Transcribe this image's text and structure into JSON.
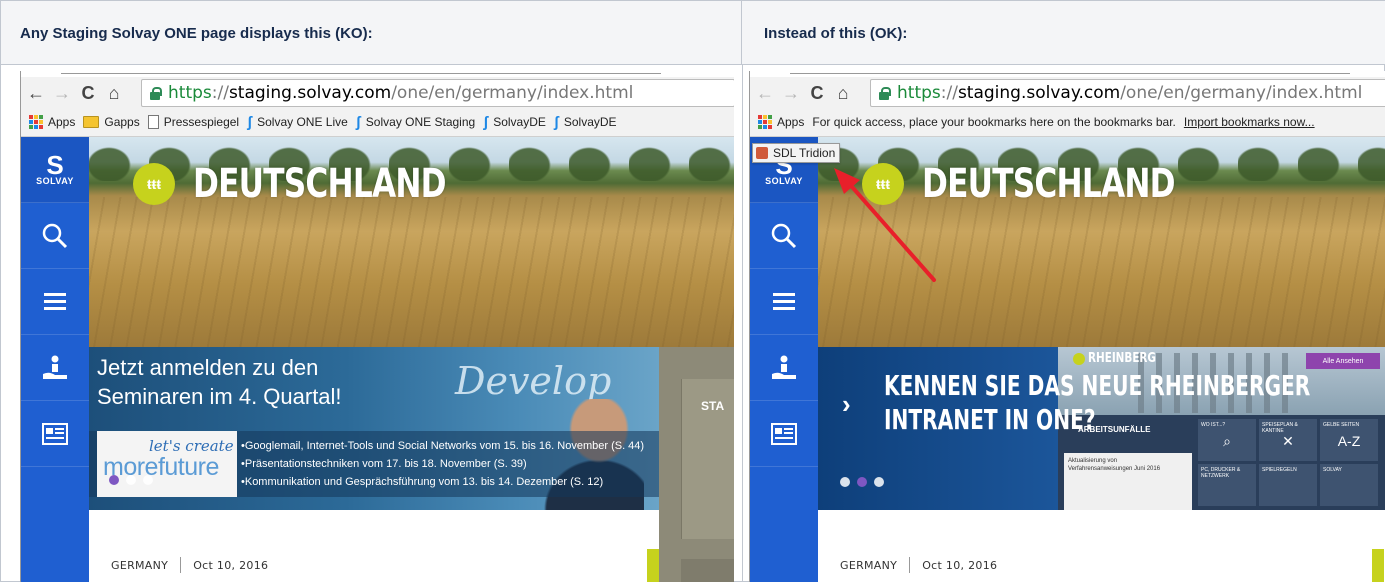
{
  "table": {
    "left_header": "Any Staging Solvay ONE page displays this (KO):",
    "right_header": "Instead of this (OK):"
  },
  "browser": {
    "url_scheme": "https",
    "url_sep": "://",
    "url_host": "staging.solvay.com",
    "url_path": "/one/en/germany/index.html"
  },
  "bookmarks_ko": {
    "apps": "Apps",
    "items": [
      "Gapps",
      "Pressespiegel",
      "Solvay ONE Live",
      "Solvay ONE Staging",
      "SolvayDE",
      "SolvayDE"
    ]
  },
  "bookmarks_ok": {
    "apps": "Apps",
    "hint": "For quick access, place your bookmarks here on the bookmarks bar.",
    "import_link": "Import bookmarks now..."
  },
  "tooltip": {
    "label": "SDL Tridion"
  },
  "sidebar": {
    "logo_letter": "S",
    "logo_text": "SOLVAY",
    "icons": [
      "search-icon",
      "menu-icon",
      "help-hand-icon",
      "news-icon"
    ]
  },
  "hero": {
    "title": "DEUTSCHLAND"
  },
  "banner_ko": {
    "heading_line1": "Jetzt anmelden zu den",
    "heading_line2": "Seminaren im 4. Quartal!",
    "develop_word": "Develop",
    "lets_create": "let's create",
    "more_future": "morefuture",
    "bullets": [
      "•Googlemail, Internet-Tools und Social Networks vom 15. bis 16. November (S. 44)",
      "•Präsentationstechniken vom 17. bis 18. November (S. 39)",
      "•Kommunikation und Gesprächsführung vom 13. bis 14. Dezember (S. 12)"
    ],
    "side_label": "STA"
  },
  "banner_ok": {
    "place": "RHEINBERG",
    "heading_line1": "KENNEN SIE DAS NEUE RHEINBERGER",
    "heading_line2": "INTRANET IN ONE?",
    "overlay_label": "ARBEITSUNFÄLLE",
    "pill_label": "Alle Ansehen",
    "card_lines": [
      "Aktualisierung von",
      "Verfahrensanweisungen Juni 2016"
    ],
    "tiles": [
      "WO IST...?",
      "SPEISEPLAN & KANTINE",
      "GELBE SEITEN",
      "PC, DRUCKER & NETZWERK",
      "SPIELREGELN",
      "SOLVAY"
    ],
    "tile_glyphs": [
      "",
      "✕",
      "A-Z"
    ]
  },
  "meta": {
    "country": "GERMANY",
    "date": "Oct 10, 2016"
  }
}
